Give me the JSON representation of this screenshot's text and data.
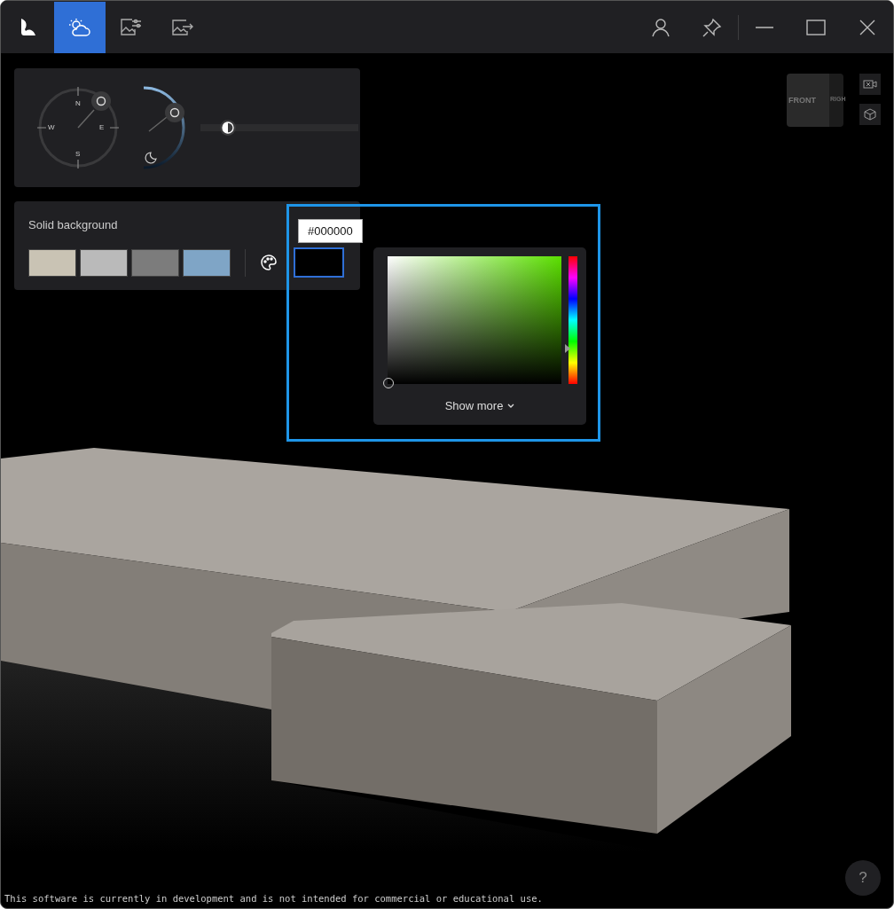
{
  "toolbar": {
    "tabs": [
      {
        "kind": "weather",
        "selected": true
      },
      {
        "kind": "image-settings",
        "selected": false
      },
      {
        "kind": "image-export",
        "selected": false
      }
    ]
  },
  "compass": {
    "north": "N",
    "east": "E",
    "south": "S",
    "west": "W"
  },
  "brightness": {
    "level": 0.12
  },
  "view_cube": {
    "front": "FRONT",
    "right": "RIGH"
  },
  "background_panel": {
    "title": "Solid background",
    "swatches": [
      {
        "color": "#c9c3b4",
        "selected": false
      },
      {
        "color": "#bababa",
        "selected": false
      },
      {
        "color": "#7c7c7c",
        "selected": false
      },
      {
        "color": "#7fa5c6",
        "selected": false
      }
    ],
    "custom": {
      "value": "#000000",
      "selected": true
    }
  },
  "color_picker": {
    "hue": {
      "level": 0.72
    },
    "show_more": "Show more",
    "expanded": false
  },
  "footer": {
    "notice": "This software is currently in development and is not intended for commercial or educational use.",
    "help": "?"
  }
}
